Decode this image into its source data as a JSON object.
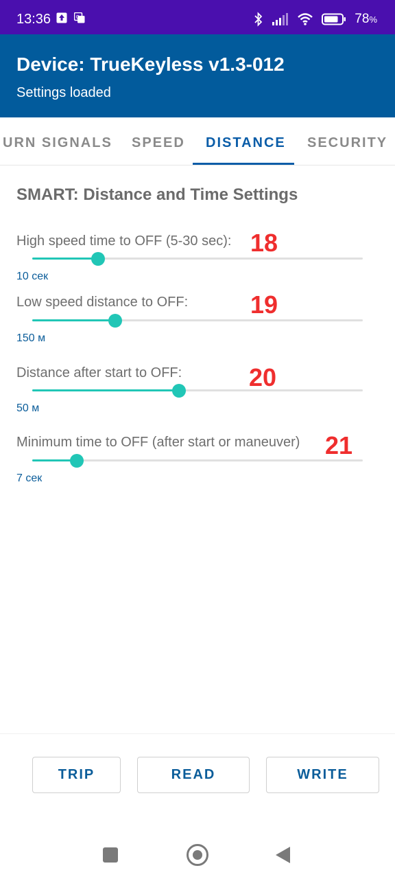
{
  "status_bar": {
    "time": "13:36",
    "battery_percent": "78",
    "battery_unit": "%",
    "battery_level": 0.78,
    "icons": [
      "upload-icon",
      "translate-icon",
      "bluetooth-icon",
      "signal-icon",
      "wifi-icon",
      "battery-icon"
    ]
  },
  "app_bar": {
    "title": "Device: TrueKeyless v1.3-012",
    "subtitle": "Settings loaded",
    "color": "#025b9c"
  },
  "tabs": {
    "items": [
      {
        "label": "URN SIGNALS"
      },
      {
        "label": "SPEED"
      },
      {
        "label": "DISTANCE",
        "active": true
      },
      {
        "label": "SECURITY"
      }
    ],
    "active_color": "#0b5da8"
  },
  "section": {
    "title": "SMART: Distance and Time Settings"
  },
  "settings": [
    {
      "label": "High speed time to OFF (5-30 sec):",
      "value": "10 сек",
      "marker": "18",
      "fraction": 0.2
    },
    {
      "label": "Low speed distance to OFF:",
      "value": "150 м",
      "marker": "19",
      "fraction": 0.25
    },
    {
      "label": "Distance after start to OFF:",
      "value": "50 м",
      "marker": "20",
      "fraction": 0.445
    },
    {
      "label": "Minimum time to OFF (after start or maneuver)",
      "value": "7 сек",
      "marker": "21",
      "fraction": 0.135
    }
  ],
  "slider_color": "#21c6b6",
  "marker_color": "#ef2e2e",
  "buttons": {
    "trip": "TRIP",
    "read": "READ",
    "write": "WRITE"
  },
  "nav": {
    "icons": [
      "recents-square-icon",
      "home-circle-icon",
      "back-triangle-icon"
    ]
  }
}
